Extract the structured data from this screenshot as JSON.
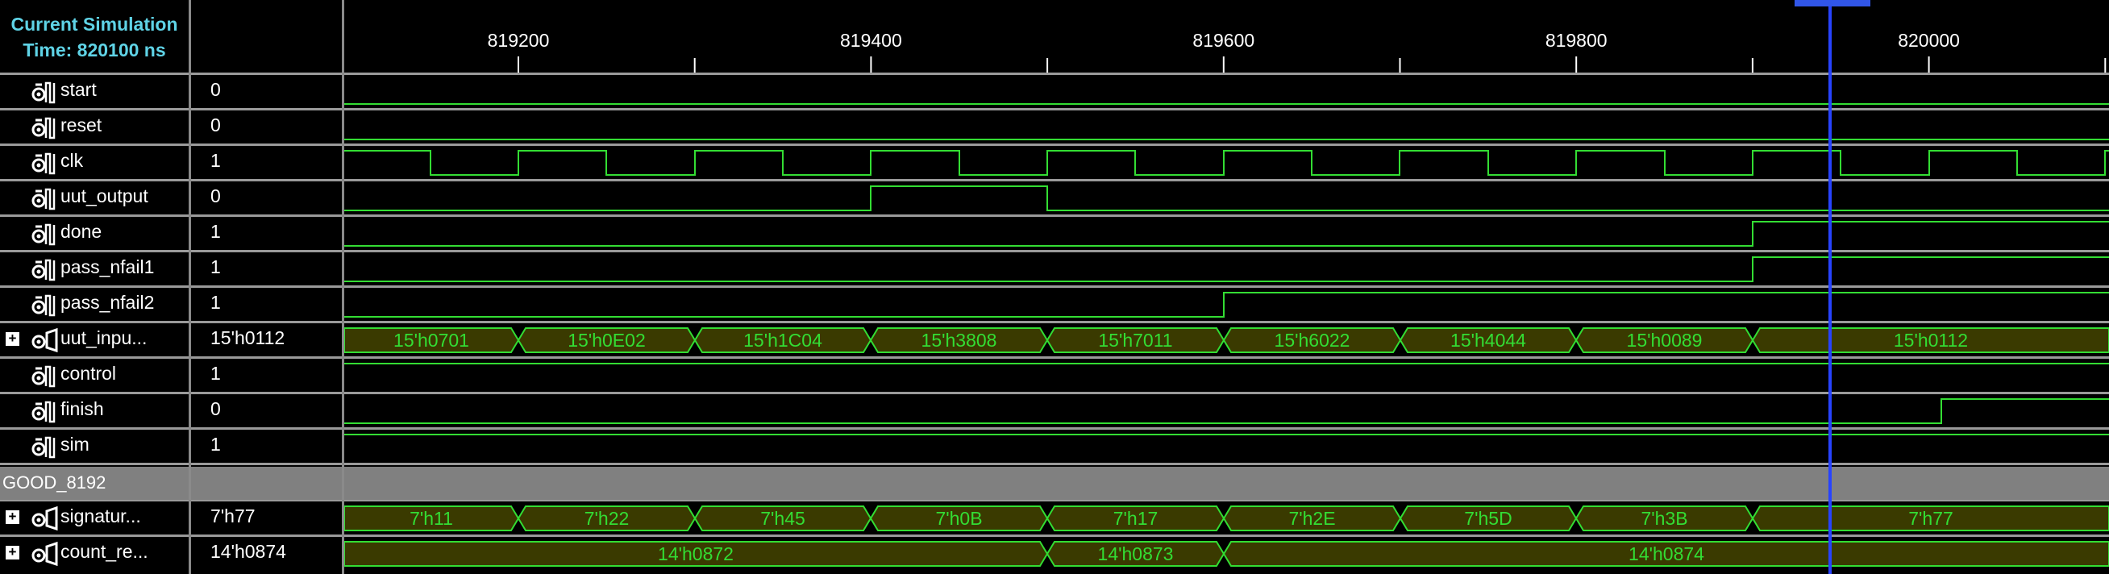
{
  "header": {
    "line1": "Current Simulation",
    "line2": "Time: 820100 ns"
  },
  "ruler": {
    "ticks": [
      "819200",
      "819400",
      "819600",
      "819800",
      "820000"
    ]
  },
  "signals": [
    {
      "name": "start",
      "value": "0",
      "icon": "signal-icon",
      "expandable": false
    },
    {
      "name": "reset",
      "value": "0",
      "icon": "signal-icon",
      "expandable": false
    },
    {
      "name": "clk",
      "value": "1",
      "icon": "signal-icon",
      "expandable": false
    },
    {
      "name": "uut_output",
      "value": "0",
      "icon": "signal-icon",
      "expandable": false
    },
    {
      "name": "done",
      "value": "1",
      "icon": "signal-icon",
      "expandable": false
    },
    {
      "name": "pass_nfail1",
      "value": "1",
      "icon": "signal-icon",
      "expandable": false
    },
    {
      "name": "pass_nfail2",
      "value": "1",
      "icon": "signal-icon",
      "expandable": false
    },
    {
      "name": "uut_inpu...",
      "value": "15'h0112",
      "icon": "bus-icon",
      "expandable": true
    },
    {
      "name": "control",
      "value": "1",
      "icon": "signal-icon",
      "expandable": false
    },
    {
      "name": "finish",
      "value": "0",
      "icon": "signal-icon",
      "expandable": false
    },
    {
      "name": "sim",
      "value": "1",
      "icon": "signal-icon",
      "expandable": false
    }
  ],
  "group": {
    "label": "GOOD_8192"
  },
  "group_signals": [
    {
      "name": "signatur...",
      "value": "7'h77",
      "icon": "bus-icon",
      "expandable": true
    },
    {
      "name": "count_re...",
      "value": "14'h0874",
      "icon": "bus-icon",
      "expandable": true
    }
  ],
  "bus_segments": {
    "uut_input": [
      "15'h0701",
      "15'h0E02",
      "15'h1C04",
      "15'h3808",
      "15'h7011",
      "15'h6022",
      "15'h4044",
      "15'h0089",
      "15'h0112"
    ],
    "signature": [
      "7'h11",
      "7'h22",
      "7'h45",
      "7'h0B",
      "7'h17",
      "7'h2E",
      "7'h5D",
      "7'h3B",
      "7'h77"
    ],
    "count_reg": [
      "14'h0872",
      "14'h0873",
      "14'h0874"
    ]
  },
  "colors": {
    "wave": "#33dd33",
    "bus_fill": "#3a3a00",
    "cursor": "#2743ff",
    "header_text": "#5fd3e6",
    "group_bg": "#808080"
  }
}
